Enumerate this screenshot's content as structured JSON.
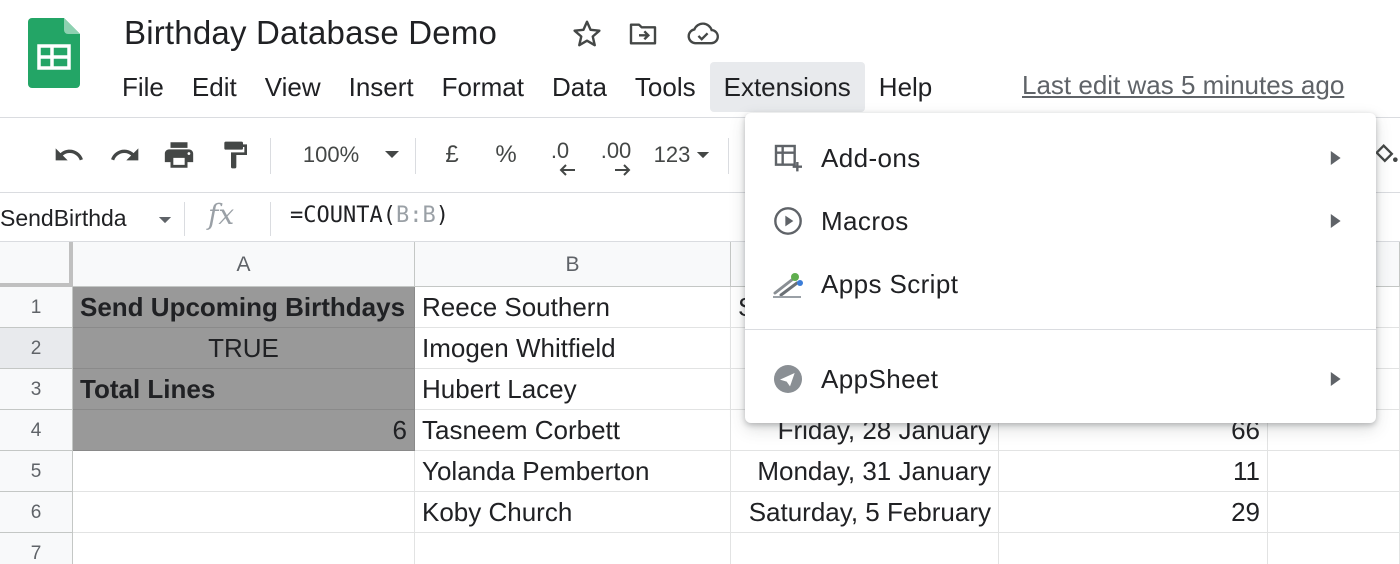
{
  "document": {
    "title": "Birthday Database Demo",
    "last_edit": "Last edit was 5 minutes ago"
  },
  "menubar": {
    "items": [
      "File",
      "Edit",
      "View",
      "Insert",
      "Format",
      "Data",
      "Tools",
      "Extensions",
      "Help"
    ],
    "active": "Extensions"
  },
  "toolbar": {
    "zoom": "100%",
    "currency": "£",
    "percent": "%",
    "decrease_decimals": ".0",
    "increase_decimals": ".00",
    "more_formats": "123"
  },
  "formula_bar": {
    "name_box": "SendBirthda",
    "fx": "fx",
    "formula_prefix": "=COUNTA(",
    "formula_ref": "B:B",
    "formula_suffix": ")"
  },
  "grid": {
    "columns": [
      "A",
      "B"
    ],
    "rows": [
      "1",
      "2",
      "3",
      "4",
      "5",
      "6",
      "7"
    ],
    "cells": {
      "A1": "Send Upcoming Birthdays",
      "A2": "TRUE",
      "A3": "Total Lines",
      "A4": "6",
      "B1": "Reece Southern",
      "B2": "Imogen Whitfield",
      "B3": "Hubert Lacey",
      "B4": "Tasneem Corbett",
      "B5": "Yolanda Pemberton",
      "B6": "Koby Church",
      "C1_partial": "S",
      "C4": "Friday, 28 January",
      "C5": "Monday, 31 January",
      "C6": "Saturday, 5 February",
      "D4": "66",
      "D5": "11",
      "D6": "29"
    }
  },
  "extensions_menu": {
    "items": [
      {
        "label": "Add-ons",
        "icon": "add-ons-icon",
        "submenu": true
      },
      {
        "label": "Macros",
        "icon": "macros-play-icon",
        "submenu": true
      },
      {
        "label": "Apps Script",
        "icon": "apps-script-icon",
        "submenu": false
      },
      {
        "label": "AppSheet",
        "icon": "appsheet-icon",
        "submenu": true
      }
    ]
  },
  "colors": {
    "sheets_green": "#23a566",
    "selected_cell_fill": "#999999",
    "menu_active_bg": "#e8eaed",
    "icon_grey": "#5f6368"
  }
}
